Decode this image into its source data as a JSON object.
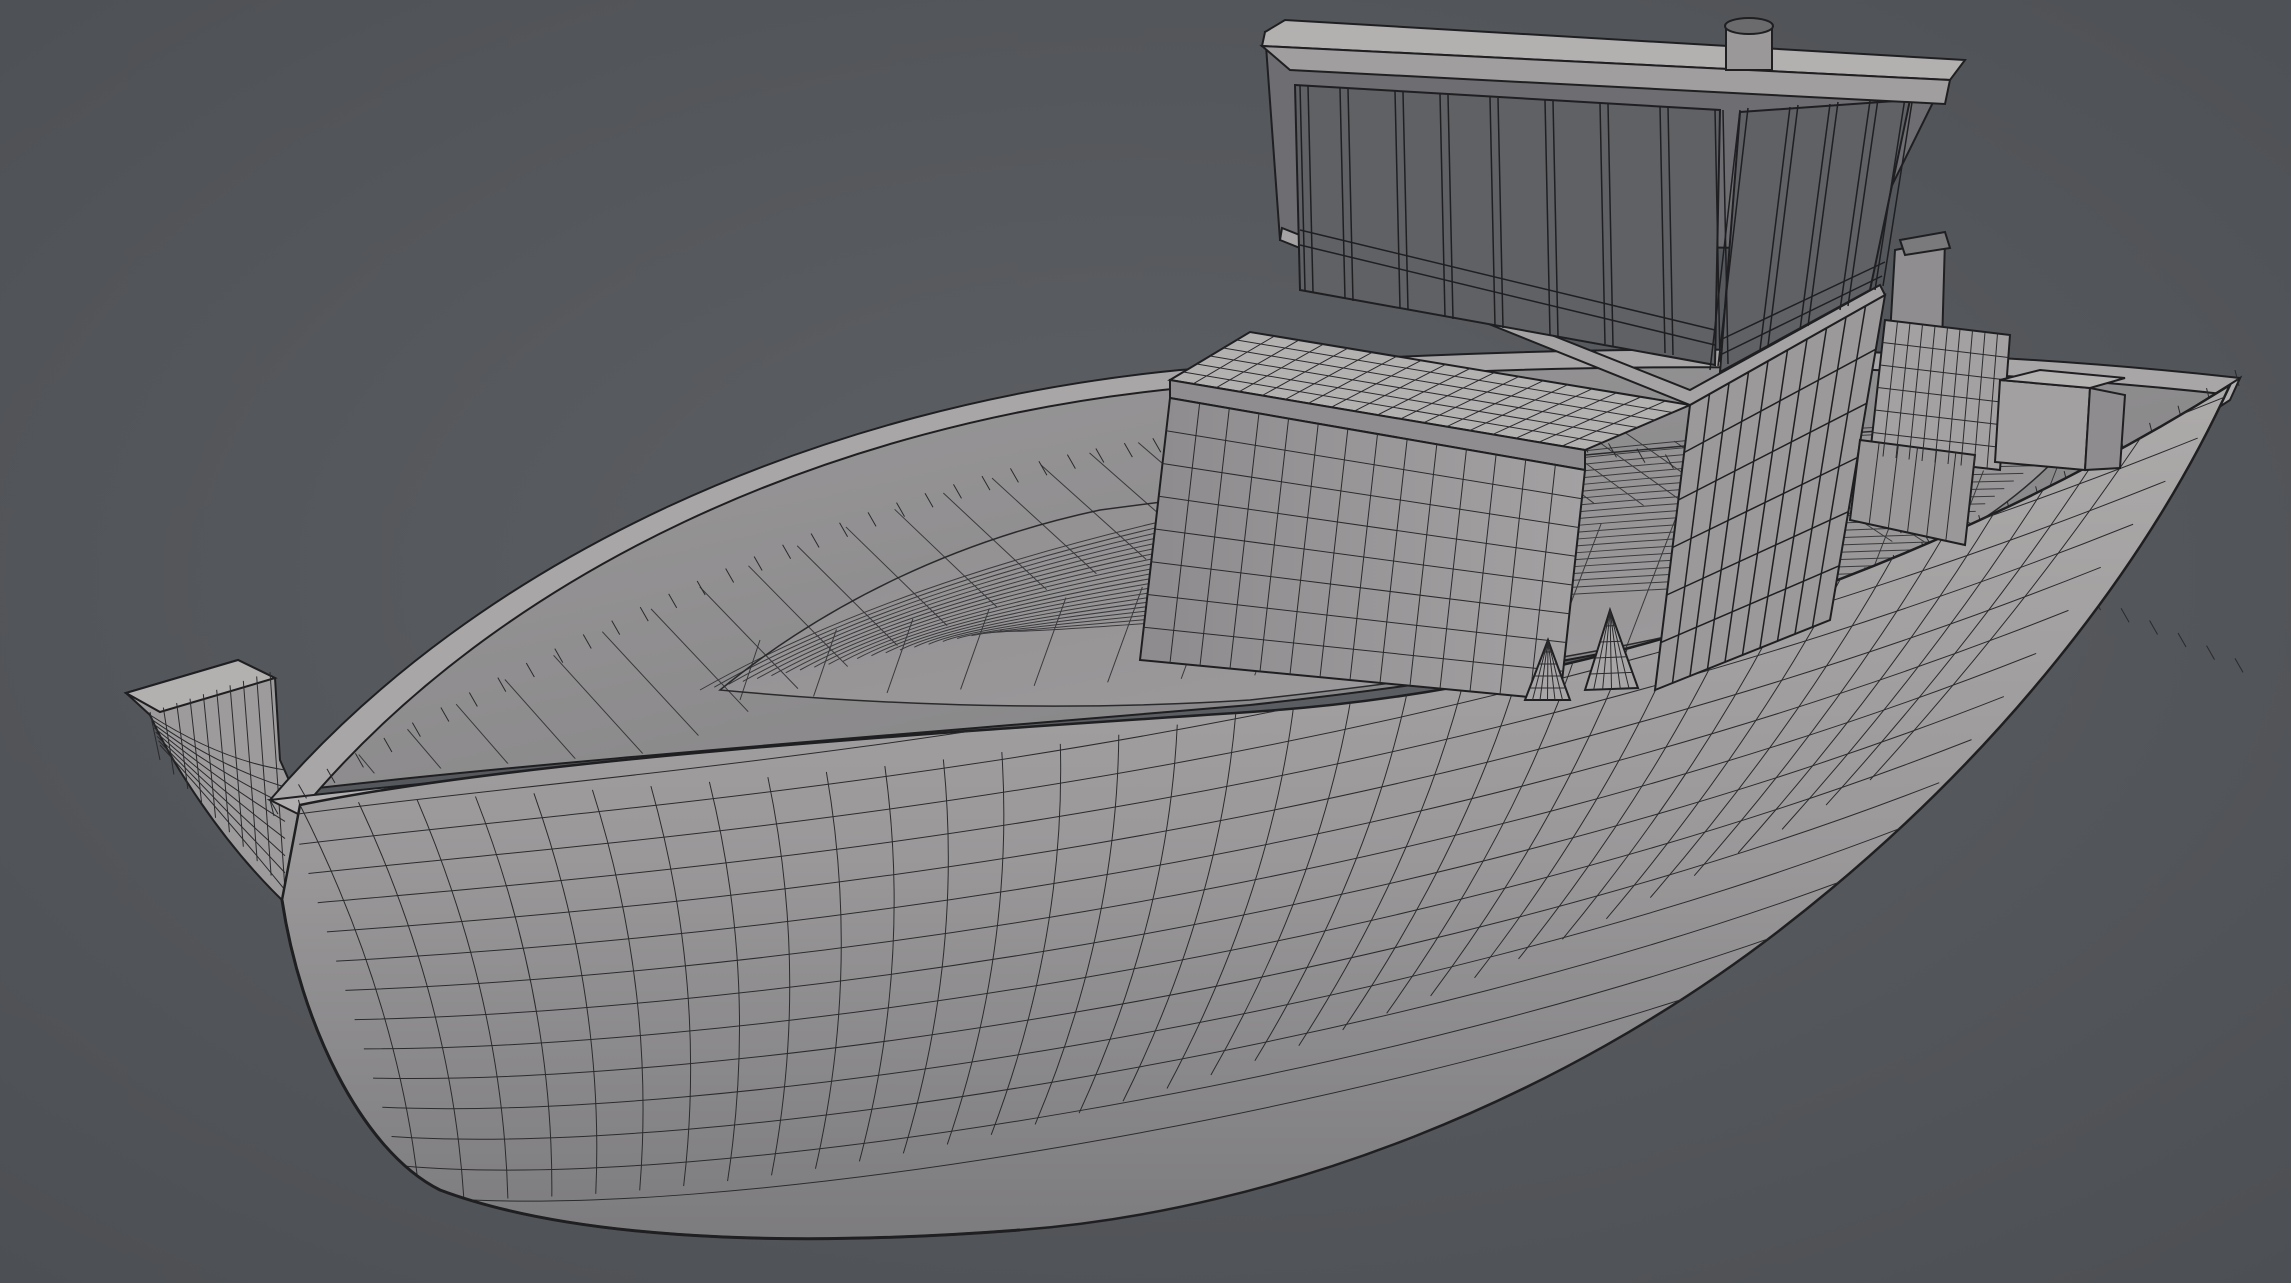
{
  "scene": {
    "subject": "boat-hull-wireframe",
    "colors": {
      "background": "#56595d",
      "background_dark": "#4c4f53",
      "surface_light": "#a7a4a5",
      "surface_mid": "#8f8d8f",
      "surface_dark": "#6a6a6d",
      "deck": "#8c8a8b",
      "wire": "#1f1f22",
      "glass": "#5e6064"
    },
    "wireframe": true,
    "labels": []
  }
}
